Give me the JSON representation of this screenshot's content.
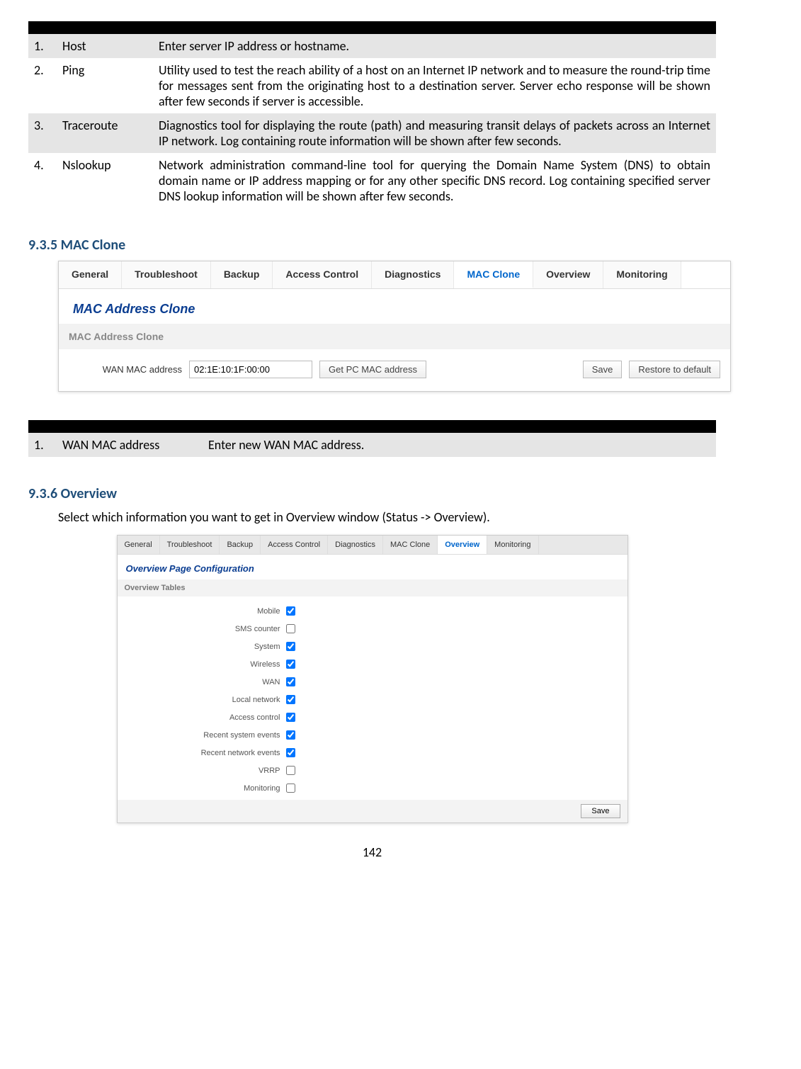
{
  "table1": {
    "rows": [
      {
        "num": "1.",
        "name": "Host",
        "desc": "Enter server IP address or hostname."
      },
      {
        "num": "2.",
        "name": "Ping",
        "desc": "Utility used to test the reach ability of a host on an Internet IP network and to measure the round-trip time for messages sent from the originating host to a destination server. Server echo response will be shown after few seconds if server is accessible."
      },
      {
        "num": "3.",
        "name": "Traceroute",
        "desc": "Diagnostics tool for displaying the route (path) and measuring transit delays of packets across an Internet IP network. Log containing route information will be shown after few seconds."
      },
      {
        "num": "4.",
        "name": "Nslookup",
        "desc": "Network administration command-line tool for querying the Domain Name System (DNS) to obtain domain name or IP address mapping or for any other specific DNS record. Log containing specified server DNS lookup information will be shown after few seconds."
      }
    ]
  },
  "sec935": {
    "num": "9.3.5",
    "title": "MAC Clone"
  },
  "macFig": {
    "tabs": [
      "General",
      "Troubleshoot",
      "Backup",
      "Access Control",
      "Diagnostics",
      "MAC Clone",
      "Overview",
      "Monitoring"
    ],
    "activeTab": "MAC Clone",
    "panelTitle": "MAC Address Clone",
    "sectionLabel": "MAC Address Clone",
    "fieldLabel": "WAN MAC address",
    "fieldValue": "02:1E:10:1F:00:00",
    "btnGet": "Get PC MAC address",
    "btnSave": "Save",
    "btnRestore": "Restore to default"
  },
  "table2": {
    "rows": [
      {
        "num": "1.",
        "name": "WAN MAC address",
        "desc": "Enter new WAN MAC address."
      }
    ]
  },
  "sec936": {
    "num": "9.3.6",
    "title": "Overview"
  },
  "sec936text": "Select which information you want to get in Overview window (Status -> Overview).",
  "ovFig": {
    "tabs": [
      "General",
      "Troubleshoot",
      "Backup",
      "Access Control",
      "Diagnostics",
      "MAC Clone",
      "Overview",
      "Monitoring"
    ],
    "activeTab": "Overview",
    "panelTitle": "Overview Page Configuration",
    "sectionLabel": "Overview Tables",
    "items": [
      {
        "label": "Mobile",
        "checked": true
      },
      {
        "label": "SMS counter",
        "checked": false
      },
      {
        "label": "System",
        "checked": true
      },
      {
        "label": "Wireless",
        "checked": true
      },
      {
        "label": "WAN",
        "checked": true
      },
      {
        "label": "Local network",
        "checked": true
      },
      {
        "label": "Access control",
        "checked": true
      },
      {
        "label": "Recent system events",
        "checked": true
      },
      {
        "label": "Recent network events",
        "checked": true
      },
      {
        "label": "VRRP",
        "checked": false
      },
      {
        "label": "Monitoring",
        "checked": false
      }
    ],
    "btnSave": "Save"
  },
  "pageNum": "142"
}
